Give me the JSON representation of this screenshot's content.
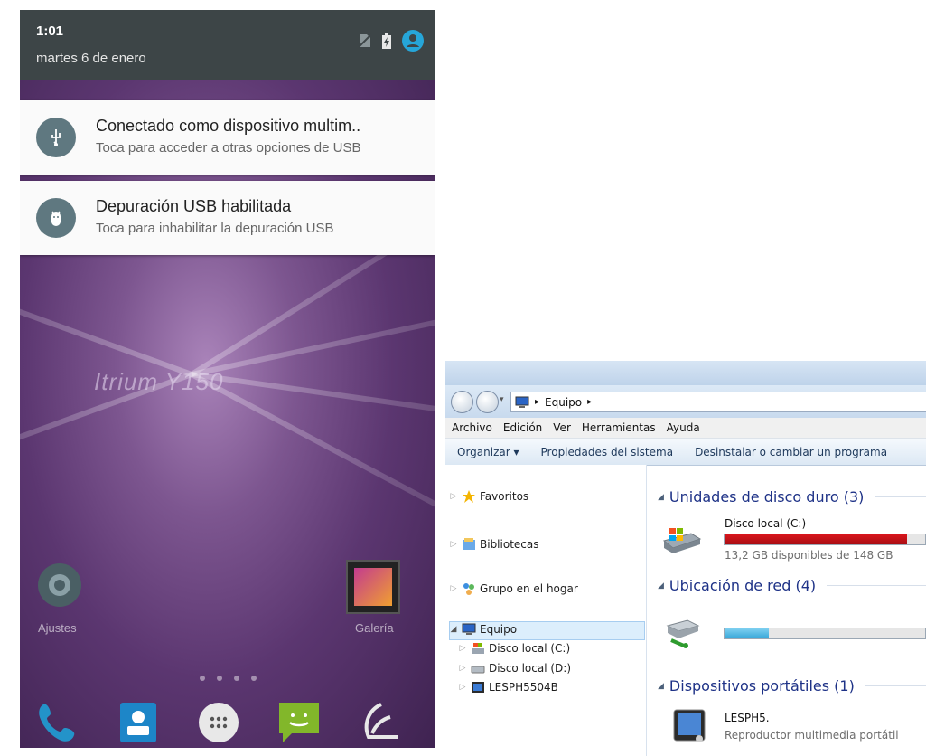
{
  "phone": {
    "status": {
      "time": "1:01",
      "date": "martes 6 de enero",
      "icons": [
        "no-sim-icon",
        "battery-charging-icon",
        "account-icon"
      ]
    },
    "notifications": [
      {
        "icon": "usb-icon",
        "title": "Conectado como dispositivo multim..",
        "text": "Toca para acceder a otras opciones de USB"
      },
      {
        "icon": "android-debug-icon",
        "title": "Depuración USB habilitada",
        "text": "Toca para inhabilitar la depuración USB"
      }
    ],
    "brand": "Itrium Y150",
    "apps": {
      "settings_label": "Ajustes",
      "gallery_label": "Galería"
    },
    "page_dots": 4,
    "dock": [
      "phone-icon",
      "contacts-icon",
      "app-drawer-icon",
      "messaging-icon",
      "browser-icon"
    ],
    "colors": {
      "wallpaper": "#5b3670",
      "statusbar": "#3d4547",
      "notif_icon_bg": "#5f7880"
    }
  },
  "explorer": {
    "address": {
      "location": "Equipo"
    },
    "menu": [
      "Archivo",
      "Edición",
      "Ver",
      "Herramientas",
      "Ayuda"
    ],
    "toolbar": {
      "organize": "Organizar",
      "system_props": "Propiedades del sistema",
      "uninstall": "Desinstalar o cambiar un programa"
    },
    "nav": {
      "favorites": "Favoritos",
      "libraries": "Bibliotecas",
      "homegroup": "Grupo en el hogar",
      "computer": "Equipo",
      "sub": [
        "Disco local (C:)",
        "Disco local (D:)",
        "LESPH5504B"
      ]
    },
    "groups": {
      "hard_drives": "Unidades de disco duro (3)",
      "network": "Ubicación de red (4)",
      "portable": "Dispositivos portátiles (1)"
    },
    "drive_c": {
      "name": "Disco local (C:)",
      "free": "13,2 GB disponibles de 148 GB",
      "used_fraction": 0.91
    },
    "network_drive": {
      "used_fraction": 0.22
    },
    "device": {
      "name": "LESPH5.",
      "type": "Reproductor multimedia portátil"
    },
    "colors": {
      "drive_bar_used": "#d9161c",
      "network_bar": "#36a6d9"
    }
  }
}
